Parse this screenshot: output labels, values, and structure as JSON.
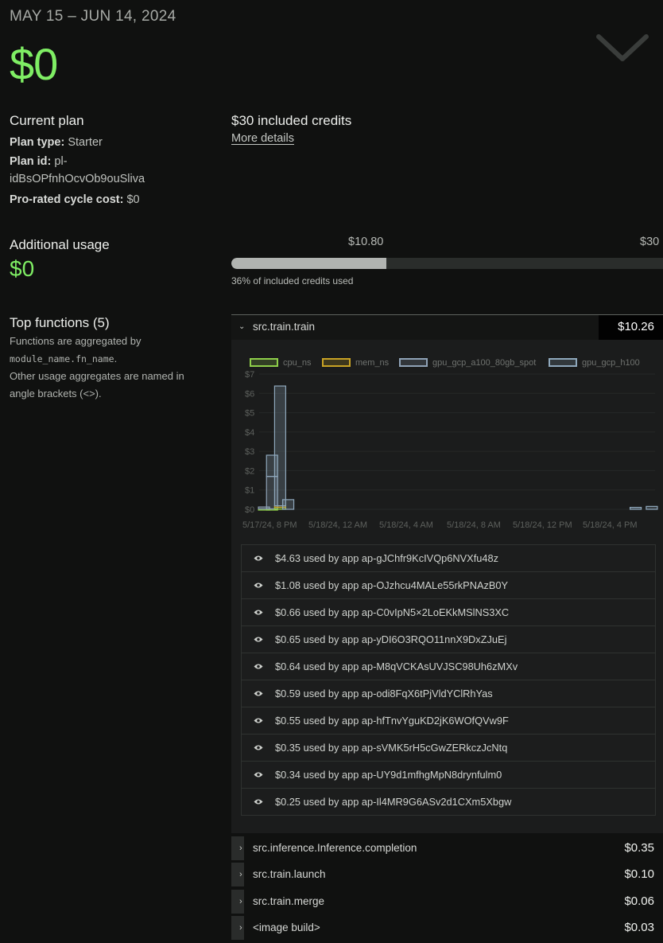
{
  "billing": {
    "period": "MAY 15 – JUN 14, 2024",
    "total": "$0"
  },
  "plan": {
    "heading": "Current plan",
    "type_label": "Plan type:",
    "type_value": "Starter",
    "id_label": "Plan id:",
    "id_value_line1": "pl-",
    "id_value_line2": "idBsOPfnhOcvOb9ouSliva",
    "cost_label": "Pro-rated cycle cost:",
    "cost_value": "$0",
    "credits_heading": "$30 included credits",
    "more_details": "More details"
  },
  "additional": {
    "heading": "Additional usage",
    "value": "$0",
    "marker_used": "$10.80",
    "marker_total": "$30",
    "progress_fraction": 0.36,
    "progress_caption": "36% of included credits used"
  },
  "top_functions": {
    "heading": "Top functions (5)",
    "desc_1": "Functions are aggregated by",
    "desc_code": "module_name.fn_name",
    "desc_dot": ".",
    "desc_2": "Other usage aggregates are named in",
    "desc_3": "angle brackets (<>)."
  },
  "expanded_function": {
    "name": "src.train.train",
    "cost": "$10.26",
    "caret": "⌄"
  },
  "colors": {
    "cpu_ns": "#8fcf4a",
    "mem_ns": "#c9a324",
    "gpu_gcp_a100_80gb_spot": "#8fa2b6",
    "gpu_gcp_h100": "#8fa8bc"
  },
  "chart_data": {
    "type": "bar",
    "stacked": true,
    "ylim": [
      0,
      7
    ],
    "yticks": [
      "$0",
      "$1",
      "$2",
      "$3",
      "$4",
      "$5",
      "$6",
      "$7"
    ],
    "x_tick_labels": [
      "5/17/24, 8 PM",
      "5/18/24, 12 AM",
      "5/18/24, 4 AM",
      "5/18/24, 8 AM",
      "5/18/24, 12 PM",
      "5/18/24, 4 PM"
    ],
    "legend": [
      "cpu_ns",
      "mem_ns",
      "gpu_gcp_a100_80gb_spot",
      "gpu_gcp_h100"
    ],
    "bars": [
      {
        "slot": 0,
        "cpu_ns": 0.02,
        "mem_ns": 0.0,
        "gpu_gcp_a100_80gb_spot": 0.1,
        "gpu_gcp_h100": 0.0
      },
      {
        "slot": 1,
        "cpu_ns": 0.02,
        "mem_ns": 0.0,
        "gpu_gcp_a100_80gb_spot": 1.68,
        "gpu_gcp_h100": 1.1
      },
      {
        "slot": 2,
        "cpu_ns": 0.1,
        "mem_ns": 0.08,
        "gpu_gcp_a100_80gb_spot": 0.0,
        "gpu_gcp_h100": 6.2
      },
      {
        "slot": 3,
        "cpu_ns": 0.0,
        "mem_ns": 0.0,
        "gpu_gcp_a100_80gb_spot": 0.0,
        "gpu_gcp_h100": 0.5
      },
      {
        "slot": 46,
        "cpu_ns": 0.0,
        "mem_ns": 0.0,
        "gpu_gcp_a100_80gb_spot": 0.0,
        "gpu_gcp_h100": 0.1
      },
      {
        "slot": 48,
        "cpu_ns": 0.0,
        "mem_ns": 0.0,
        "gpu_gcp_a100_80gb_spot": 0.0,
        "gpu_gcp_h100": 0.15
      }
    ]
  },
  "apps": [
    {
      "text": "$4.63 used by app ap-gJChfr9KcIVQp6NVXfu48z"
    },
    {
      "text": "$1.08 used by app ap-OJzhcu4MALe55rkPNAzB0Y"
    },
    {
      "text": "$0.66 used by app ap-C0vIpN5×2LoEKkMSlNS3XC"
    },
    {
      "text": "$0.65 used by app ap-yDI6O3RQO11nnX9DxZJuEj"
    },
    {
      "text": "$0.64 used by app ap-M8qVCKAsUVJSC98Uh6zMXv"
    },
    {
      "text": "$0.59 used by app ap-odi8FqX6tPjVldYClRhYas"
    },
    {
      "text": "$0.55 used by app ap-hfTnvYguKD2jK6WOfQVw9F"
    },
    {
      "text": "$0.35 used by app ap-sVMK5rH5cGwZERkczJcNtq"
    },
    {
      "text": "$0.34 used by app ap-UY9d1mfhgMpN8drynfulm0"
    },
    {
      "text": "$0.25 used by app ap-Il4MR9G6ASv2d1CXm5Xbgw"
    }
  ],
  "other_functions": [
    {
      "name": "src.inference.Inference.completion",
      "cost": "$0.35",
      "caret": "›"
    },
    {
      "name": "src.train.launch",
      "cost": "$0.10",
      "caret": "›"
    },
    {
      "name": "src.train.merge",
      "cost": "$0.06",
      "caret": "›"
    },
    {
      "name": "<image build>",
      "cost": "$0.03",
      "caret": "›"
    }
  ]
}
